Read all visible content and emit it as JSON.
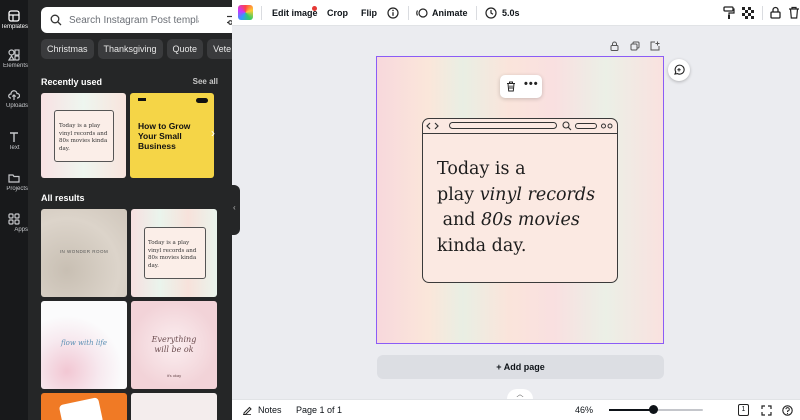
{
  "rail": {
    "items": [
      {
        "label": "Templates",
        "icon": "templates-icon"
      },
      {
        "label": "Elements",
        "icon": "elements-icon"
      },
      {
        "label": "Uploads",
        "icon": "uploads-icon"
      },
      {
        "label": "Text",
        "icon": "text-icon"
      },
      {
        "label": "Projects",
        "icon": "folder-icon"
      },
      {
        "label": "Apps",
        "icon": "apps-icon"
      }
    ]
  },
  "panel": {
    "search_placeholder": "Search Instagram Post templates",
    "chips": [
      "Christmas",
      "Thanksgiving",
      "Quote",
      "Vete"
    ],
    "recently_used": "Recently used",
    "see_all": "See all",
    "all_results": "All results",
    "recent_thumb1_text": "Today is a play vinyl records and 80s movies kinda day.",
    "recent_thumb2_text": "How to Grow Your Small Business",
    "result1_text": "IN WONDER ROOM",
    "result2_text": "Today is a play vinyl records and 80s movies kinda day.",
    "result3_text": "flow with life",
    "result4_text": "Everything will be ok",
    "result4_sub": "it's okay",
    "accent_yellow": "#f5d547"
  },
  "toolbar": {
    "edit_image": "Edit image",
    "crop": "Crop",
    "flip": "Flip",
    "animate": "Animate",
    "duration": "5.0s"
  },
  "canvas": {
    "line1": "Today is a",
    "line2a": "play ",
    "line2b": "vinyl records",
    "line3a": " and ",
    "line3b": "80s movies",
    "line4": "kinda day.",
    "selection_color": "#8b5cf6"
  },
  "add_page": "+ Add page",
  "bottom": {
    "notes": "Notes",
    "page": "Page 1 of 1",
    "zoom": "46%",
    "zoom_value": 46,
    "page_count": "1"
  }
}
